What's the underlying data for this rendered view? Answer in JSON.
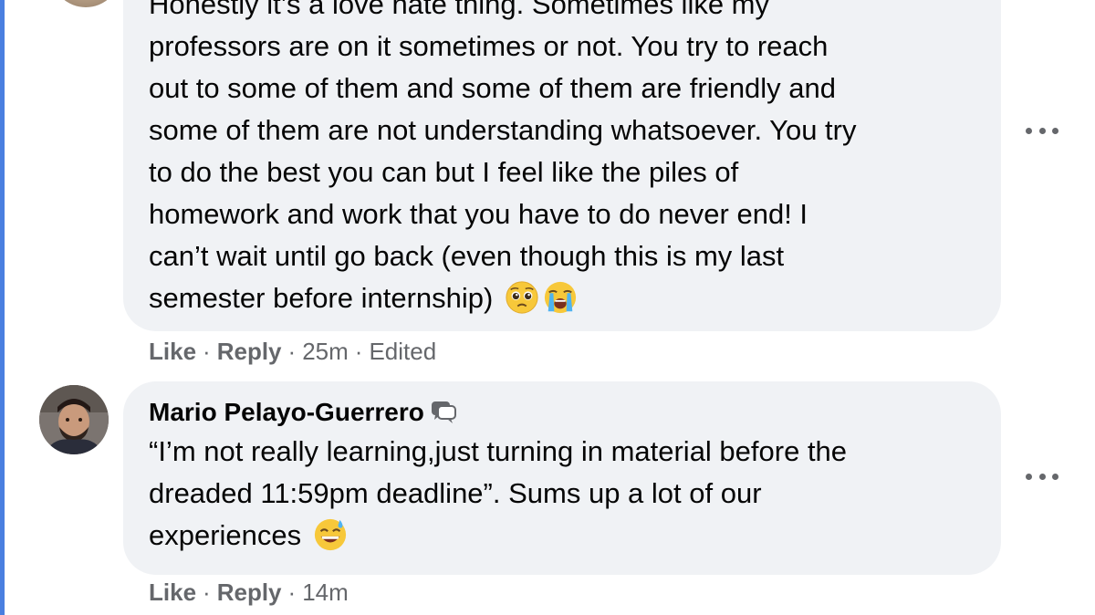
{
  "comments": [
    {
      "author": "",
      "lines": [
        "Honestly it’s a love hate thing. Sometimes like my",
        "professors are on it sometimes or not. You try to reach",
        "out to some of them and some of them are friendly and",
        "some of them are not understanding whatsoever. You try",
        "to do the best you can but I feel like the piles of",
        "homework and work that you have to do never end! I",
        "can’t wait until go back (even though this is my last",
        "semester before internship)"
      ],
      "emojis": [
        "pleading-face",
        "loudly-crying-face"
      ],
      "actions": {
        "like": "Like",
        "reply": "Reply",
        "time": "25m",
        "edited": "Edited",
        "separator": "·"
      }
    },
    {
      "author": "Mario Pelayo-Guerrero",
      "author_badge_icon": "conversation-starter-badge-icon",
      "lines": [
        "“I’m not really learning,just turning in material before the",
        "dreaded 11:59pm deadline”. Sums up a lot of our",
        "experiences"
      ],
      "emojis": [
        "grinning-face-with-sweat"
      ],
      "actions": {
        "like": "Like",
        "reply": "Reply",
        "time": "14m",
        "separator": "·"
      }
    }
  ],
  "colors": {
    "bubble": "#f0f2f5",
    "text": "#050505",
    "meta": "#65676b",
    "thread_line": "#4a7fe0"
  }
}
